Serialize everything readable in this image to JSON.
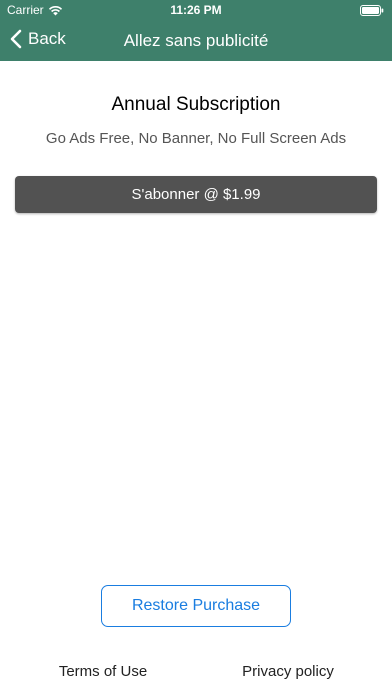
{
  "status_bar": {
    "carrier": "Carrier",
    "time": "11:26 PM",
    "icons": [
      "wifi-icon",
      "battery-icon"
    ]
  },
  "nav": {
    "back_label": "Back",
    "back_icon": "chevron-left-icon",
    "title": "Allez sans publicité"
  },
  "content": {
    "headline": "Annual Subscription",
    "subline": "Go Ads Free, No Banner, No Full Screen Ads",
    "subscribe_label": "S'abonner @ $1.99"
  },
  "footer": {
    "restore_label": "Restore Purchase",
    "terms_label": "Terms of Use",
    "privacy_label": "Privacy policy"
  },
  "colors": {
    "nav_background": "#3e806b",
    "subscribe_button": "#525252",
    "restore_accent": "#1a7de0"
  }
}
